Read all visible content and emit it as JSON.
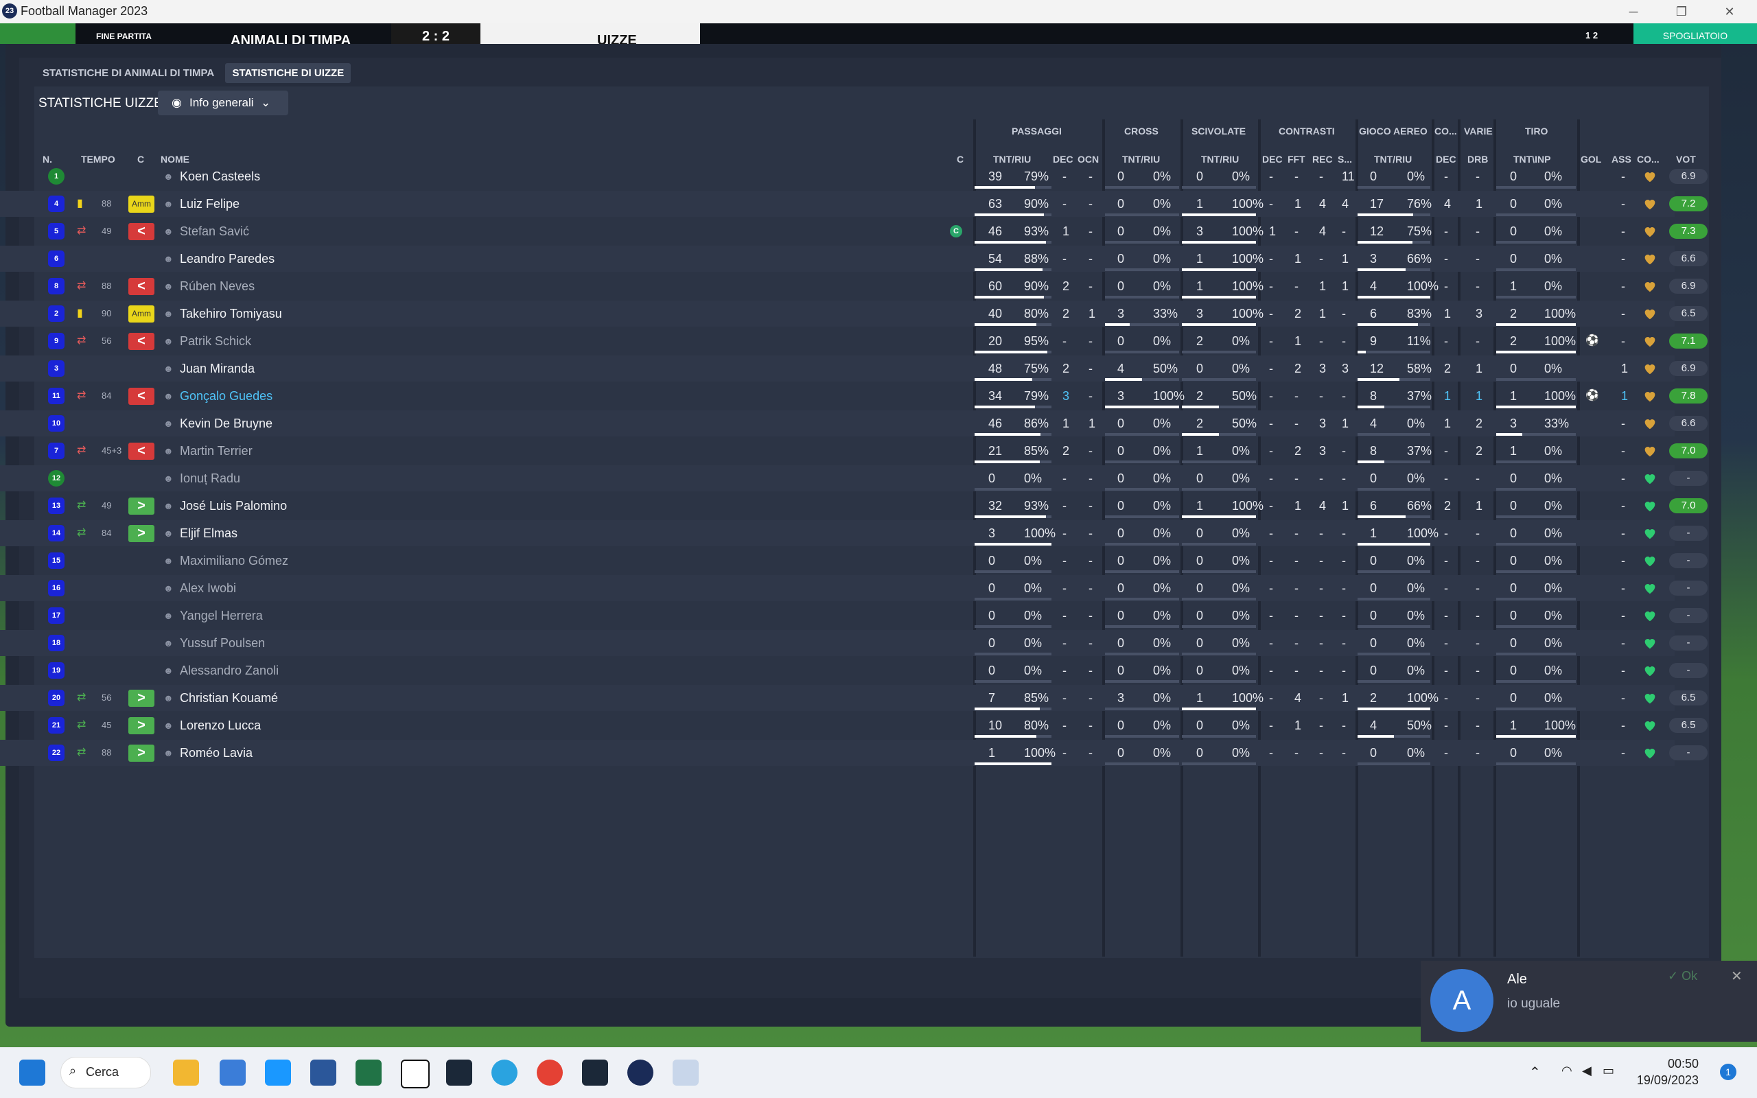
{
  "window": {
    "title": "Football Manager 2023",
    "app_icon": "23"
  },
  "scorebar": {
    "status": "FINE PARTITA",
    "home": "ANIMALI DI TIMPA",
    "score": "2 : 2",
    "away": "UIZZE",
    "extra": "1 2",
    "right": "SPOGLIATOIO"
  },
  "tabs": [
    "STATISTICHE DI ANIMALI DI TIMPA",
    "STATISTICHE DI UIZZE"
  ],
  "section_title": "STATISTICHE UIZZE",
  "view_dropdown": "Info generali",
  "group_headers": {
    "passaggi": "PASSAGGI",
    "cross": "CROSS",
    "scivolate": "SCIVOLATE",
    "contrasti": "CONTRASTI",
    "gioco_aereo": "GIOCO AEREO",
    "co": "CO...",
    "varie": "VARIE",
    "tiro": "TIRO"
  },
  "columns": {
    "n": "N.",
    "tempo": "TEMPO",
    "c": "C",
    "nome": "NOME",
    "c2": "C",
    "pass_tnt": "TNT/RIU",
    "pass_dec": "DEC",
    "pass_ocn": "OCN",
    "cross_tnt": "TNT/RIU",
    "sciv_tnt": "TNT/RIU",
    "con_dec": "DEC",
    "con_fft": "FFT",
    "con_rec": "REC",
    "con_s": "S...",
    "aereo_tnt": "TNT/RIU",
    "co_dec": "DEC",
    "drb": "DRB",
    "tiro_tnt": "TNT\\INP",
    "gol": "GOL",
    "ass": "ASS",
    "cond": "CO...",
    "vot": "VOT"
  },
  "players": [
    {
      "n": "1",
      "kit": "green",
      "card": "",
      "tempo": "",
      "sub": "",
      "name": "Koen Casteels",
      "cap": "",
      "pt": "39",
      "pp": "79%",
      "pd": "-",
      "po": "-",
      "ct": "0",
      "cp": "0%",
      "st": "0",
      "sp": "0%",
      "kd": "-",
      "kf": "-",
      "kr": "-",
      "ks": "11",
      "at": "0",
      "ap": "0%",
      "cd": "-",
      "dr": "-",
      "tt": "0",
      "tp": "0%",
      "gol": "",
      "ass": "-",
      "vot": "6.9",
      "hi": false,
      "bench": false,
      "link": false
    },
    {
      "n": "4",
      "kit": "blue",
      "card": "yellow",
      "tempo": "88",
      "sub": "amm",
      "name": "Luiz Felipe",
      "cap": "",
      "pt": "63",
      "pp": "90%",
      "pd": "-",
      "po": "-",
      "ct": "0",
      "cp": "0%",
      "st": "1",
      "sp": "100%",
      "kd": "-",
      "kf": "1",
      "kr": "4",
      "ks": "4",
      "at": "17",
      "ap": "76%",
      "cd": "4",
      "dr": "1",
      "tt": "0",
      "tp": "0%",
      "gol": "",
      "ass": "-",
      "vot": "7.2",
      "hi": true,
      "bench": false,
      "link": false
    },
    {
      "n": "5",
      "kit": "blue",
      "card": "swap",
      "tempo": "49",
      "sub": "out",
      "name": "Stefan Savić",
      "cap": "C",
      "pt": "46",
      "pp": "93%",
      "pd": "1",
      "po": "-",
      "ct": "0",
      "cp": "0%",
      "st": "3",
      "sp": "100%",
      "kd": "1",
      "kf": "-",
      "kr": "4",
      "ks": "-",
      "at": "12",
      "ap": "75%",
      "cd": "-",
      "dr": "-",
      "tt": "0",
      "tp": "0%",
      "gol": "",
      "ass": "-",
      "vot": "7.3",
      "hi": true,
      "bench": true,
      "link": false
    },
    {
      "n": "6",
      "kit": "blue",
      "card": "",
      "tempo": "",
      "sub": "",
      "name": "Leandro Paredes",
      "cap": "",
      "pt": "54",
      "pp": "88%",
      "pd": "-",
      "po": "-",
      "ct": "0",
      "cp": "0%",
      "st": "1",
      "sp": "100%",
      "kd": "-",
      "kf": "1",
      "kr": "-",
      "ks": "1",
      "at": "3",
      "ap": "66%",
      "cd": "-",
      "dr": "-",
      "tt": "0",
      "tp": "0%",
      "gol": "",
      "ass": "-",
      "vot": "6.6",
      "hi": false,
      "bench": false,
      "link": false
    },
    {
      "n": "8",
      "kit": "blue",
      "card": "swap",
      "tempo": "88",
      "sub": "out",
      "name": "Rúben Neves",
      "cap": "",
      "pt": "60",
      "pp": "90%",
      "pd": "2",
      "po": "-",
      "ct": "0",
      "cp": "0%",
      "st": "1",
      "sp": "100%",
      "kd": "-",
      "kf": "-",
      "kr": "1",
      "ks": "1",
      "at": "4",
      "ap": "100%",
      "cd": "-",
      "dr": "-",
      "tt": "1",
      "tp": "0%",
      "gol": "",
      "ass": "-",
      "vot": "6.9",
      "hi": false,
      "bench": true,
      "link": false
    },
    {
      "n": "2",
      "kit": "blue",
      "card": "yellow",
      "tempo": "90",
      "sub": "amm",
      "name": "Takehiro Tomiyasu",
      "cap": "",
      "pt": "40",
      "pp": "80%",
      "pd": "2",
      "po": "1",
      "ct": "3",
      "cp": "33%",
      "st": "3",
      "sp": "100%",
      "kd": "-",
      "kf": "2",
      "kr": "1",
      "ks": "-",
      "at": "6",
      "ap": "83%",
      "cd": "1",
      "dr": "3",
      "tt": "2",
      "tp": "100%",
      "gol": "",
      "ass": "-",
      "vot": "6.5",
      "hi": false,
      "bench": false,
      "link": false
    },
    {
      "n": "9",
      "kit": "blue",
      "card": "swap",
      "tempo": "56",
      "sub": "out",
      "name": "Patrik Schick",
      "cap": "",
      "pt": "20",
      "pp": "95%",
      "pd": "-",
      "po": "-",
      "ct": "0",
      "cp": "0%",
      "st": "2",
      "sp": "0%",
      "kd": "-",
      "kf": "1",
      "kr": "-",
      "ks": "-",
      "at": "9",
      "ap": "11%",
      "cd": "-",
      "dr": "-",
      "tt": "2",
      "tp": "100%",
      "gol": "ball",
      "ass": "-",
      "vot": "7.1",
      "hi": true,
      "bench": true,
      "link": false
    },
    {
      "n": "3",
      "kit": "blue",
      "card": "",
      "tempo": "",
      "sub": "",
      "name": "Juan Miranda",
      "cap": "",
      "pt": "48",
      "pp": "75%",
      "pd": "2",
      "po": "-",
      "ct": "4",
      "cp": "50%",
      "st": "0",
      "sp": "0%",
      "kd": "-",
      "kf": "2",
      "kr": "3",
      "ks": "3",
      "at": "12",
      "ap": "58%",
      "cd": "2",
      "dr": "1",
      "tt": "0",
      "tp": "0%",
      "gol": "",
      "ass": "1",
      "vot": "6.9",
      "hi": false,
      "bench": false,
      "link": false
    },
    {
      "n": "11",
      "kit": "blue",
      "card": "swap",
      "tempo": "84",
      "sub": "out",
      "name": "Gonçalo Guedes",
      "cap": "",
      "pt": "34",
      "pp": "79%",
      "pd": "3",
      "po": "-",
      "ct": "3",
      "cp": "100%",
      "st": "2",
      "sp": "50%",
      "kd": "-",
      "kf": "-",
      "kr": "-",
      "ks": "-",
      "at": "8",
      "ap": "37%",
      "cd": "1",
      "dr": "1",
      "tt": "1",
      "tp": "100%",
      "gol": "ball",
      "ass": "1",
      "vot": "7.8",
      "hi": true,
      "bench": false,
      "link": true
    },
    {
      "n": "10",
      "kit": "blue",
      "card": "",
      "tempo": "",
      "sub": "",
      "name": "Kevin De Bruyne",
      "cap": "",
      "pt": "46",
      "pp": "86%",
      "pd": "1",
      "po": "1",
      "ct": "0",
      "cp": "0%",
      "st": "2",
      "sp": "50%",
      "kd": "-",
      "kf": "-",
      "kr": "3",
      "ks": "1",
      "at": "4",
      "ap": "0%",
      "cd": "1",
      "dr": "2",
      "tt": "3",
      "tp": "33%",
      "gol": "",
      "ass": "-",
      "vot": "6.6",
      "hi": false,
      "bench": false,
      "link": false
    },
    {
      "n": "7",
      "kit": "blue",
      "card": "swap",
      "tempo": "45+3",
      "sub": "out",
      "name": "Martin Terrier",
      "cap": "",
      "pt": "21",
      "pp": "85%",
      "pd": "2",
      "po": "-",
      "ct": "0",
      "cp": "0%",
      "st": "1",
      "sp": "0%",
      "kd": "-",
      "kf": "2",
      "kr": "3",
      "ks": "-",
      "at": "8",
      "ap": "37%",
      "cd": "-",
      "dr": "2",
      "tt": "1",
      "tp": "0%",
      "gol": "",
      "ass": "-",
      "vot": "7.0",
      "hi": true,
      "bench": true,
      "link": false
    },
    {
      "n": "12",
      "kit": "green",
      "card": "",
      "tempo": "",
      "sub": "",
      "name": "Ionuț Radu",
      "cap": "",
      "pt": "0",
      "pp": "0%",
      "pd": "-",
      "po": "-",
      "ct": "0",
      "cp": "0%",
      "st": "0",
      "sp": "0%",
      "kd": "-",
      "kf": "-",
      "kr": "-",
      "ks": "-",
      "at": "0",
      "ap": "0%",
      "cd": "-",
      "dr": "-",
      "tt": "0",
      "tp": "0%",
      "gol": "",
      "ass": "-",
      "vot": "-",
      "hi": false,
      "bench": true,
      "link": false
    },
    {
      "n": "13",
      "kit": "blue",
      "card": "swapin",
      "tempo": "49",
      "sub": "in",
      "name": "José Luis Palomino",
      "cap": "",
      "pt": "32",
      "pp": "93%",
      "pd": "-",
      "po": "-",
      "ct": "0",
      "cp": "0%",
      "st": "1",
      "sp": "100%",
      "kd": "-",
      "kf": "1",
      "kr": "4",
      "ks": "1",
      "at": "6",
      "ap": "66%",
      "cd": "2",
      "dr": "1",
      "tt": "0",
      "tp": "0%",
      "gol": "",
      "ass": "-",
      "vot": "7.0",
      "hi": true,
      "bench": false,
      "link": false
    },
    {
      "n": "14",
      "kit": "blue",
      "card": "swapin",
      "tempo": "84",
      "sub": "in",
      "name": "Eljif Elmas",
      "cap": "",
      "pt": "3",
      "pp": "100%",
      "pd": "-",
      "po": "-",
      "ct": "0",
      "cp": "0%",
      "st": "0",
      "sp": "0%",
      "kd": "-",
      "kf": "-",
      "kr": "-",
      "ks": "-",
      "at": "1",
      "ap": "100%",
      "cd": "-",
      "dr": "-",
      "tt": "0",
      "tp": "0%",
      "gol": "",
      "ass": "-",
      "vot": "-",
      "hi": false,
      "bench": false,
      "link": false
    },
    {
      "n": "15",
      "kit": "blue",
      "card": "",
      "tempo": "",
      "sub": "",
      "name": "Maximiliano Gómez",
      "cap": "",
      "pt": "0",
      "pp": "0%",
      "pd": "-",
      "po": "-",
      "ct": "0",
      "cp": "0%",
      "st": "0",
      "sp": "0%",
      "kd": "-",
      "kf": "-",
      "kr": "-",
      "ks": "-",
      "at": "0",
      "ap": "0%",
      "cd": "-",
      "dr": "-",
      "tt": "0",
      "tp": "0%",
      "gol": "",
      "ass": "-",
      "vot": "-",
      "hi": false,
      "bench": true,
      "link": false
    },
    {
      "n": "16",
      "kit": "blue",
      "card": "",
      "tempo": "",
      "sub": "",
      "name": "Alex Iwobi",
      "cap": "",
      "pt": "0",
      "pp": "0%",
      "pd": "-",
      "po": "-",
      "ct": "0",
      "cp": "0%",
      "st": "0",
      "sp": "0%",
      "kd": "-",
      "kf": "-",
      "kr": "-",
      "ks": "-",
      "at": "0",
      "ap": "0%",
      "cd": "-",
      "dr": "-",
      "tt": "0",
      "tp": "0%",
      "gol": "",
      "ass": "-",
      "vot": "-",
      "hi": false,
      "bench": true,
      "link": false
    },
    {
      "n": "17",
      "kit": "blue",
      "card": "",
      "tempo": "",
      "sub": "",
      "name": "Yangel Herrera",
      "cap": "",
      "pt": "0",
      "pp": "0%",
      "pd": "-",
      "po": "-",
      "ct": "0",
      "cp": "0%",
      "st": "0",
      "sp": "0%",
      "kd": "-",
      "kf": "-",
      "kr": "-",
      "ks": "-",
      "at": "0",
      "ap": "0%",
      "cd": "-",
      "dr": "-",
      "tt": "0",
      "tp": "0%",
      "gol": "",
      "ass": "-",
      "vot": "-",
      "hi": false,
      "bench": true,
      "link": false
    },
    {
      "n": "18",
      "kit": "blue",
      "card": "",
      "tempo": "",
      "sub": "",
      "name": "Yussuf Poulsen",
      "cap": "",
      "pt": "0",
      "pp": "0%",
      "pd": "-",
      "po": "-",
      "ct": "0",
      "cp": "0%",
      "st": "0",
      "sp": "0%",
      "kd": "-",
      "kf": "-",
      "kr": "-",
      "ks": "-",
      "at": "0",
      "ap": "0%",
      "cd": "-",
      "dr": "-",
      "tt": "0",
      "tp": "0%",
      "gol": "",
      "ass": "-",
      "vot": "-",
      "hi": false,
      "bench": true,
      "link": false
    },
    {
      "n": "19",
      "kit": "blue",
      "card": "",
      "tempo": "",
      "sub": "",
      "name": "Alessandro Zanoli",
      "cap": "",
      "pt": "0",
      "pp": "0%",
      "pd": "-",
      "po": "-",
      "ct": "0",
      "cp": "0%",
      "st": "0",
      "sp": "0%",
      "kd": "-",
      "kf": "-",
      "kr": "-",
      "ks": "-",
      "at": "0",
      "ap": "0%",
      "cd": "-",
      "dr": "-",
      "tt": "0",
      "tp": "0%",
      "gol": "",
      "ass": "-",
      "vot": "-",
      "hi": false,
      "bench": true,
      "link": false
    },
    {
      "n": "20",
      "kit": "blue",
      "card": "swapin",
      "tempo": "56",
      "sub": "in",
      "name": "Christian Kouamé",
      "cap": "",
      "pt": "7",
      "pp": "85%",
      "pd": "-",
      "po": "-",
      "ct": "3",
      "cp": "0%",
      "st": "1",
      "sp": "100%",
      "kd": "-",
      "kf": "4",
      "kr": "-",
      "ks": "1",
      "at": "2",
      "ap": "100%",
      "cd": "-",
      "dr": "-",
      "tt": "0",
      "tp": "0%",
      "gol": "",
      "ass": "-",
      "vot": "6.5",
      "hi": false,
      "bench": false,
      "link": false
    },
    {
      "n": "21",
      "kit": "blue",
      "card": "swapin",
      "tempo": "45",
      "sub": "in",
      "name": "Lorenzo Lucca",
      "cap": "",
      "pt": "10",
      "pp": "80%",
      "pd": "-",
      "po": "-",
      "ct": "0",
      "cp": "0%",
      "st": "0",
      "sp": "0%",
      "kd": "-",
      "kf": "1",
      "kr": "-",
      "ks": "-",
      "at": "4",
      "ap": "50%",
      "cd": "-",
      "dr": "-",
      "tt": "1",
      "tp": "100%",
      "gol": "",
      "ass": "-",
      "vot": "6.5",
      "hi": false,
      "bench": false,
      "link": false
    },
    {
      "n": "22",
      "kit": "blue",
      "card": "swapin",
      "tempo": "88",
      "sub": "in",
      "name": "Roméo Lavia",
      "cap": "",
      "pt": "1",
      "pp": "100%",
      "pd": "-",
      "po": "-",
      "ct": "0",
      "cp": "0%",
      "st": "0",
      "sp": "0%",
      "kd": "-",
      "kf": "-",
      "kr": "-",
      "ks": "-",
      "at": "0",
      "ap": "0%",
      "cd": "-",
      "dr": "-",
      "tt": "0",
      "tp": "0%",
      "gol": "",
      "ass": "-",
      "vot": "-",
      "hi": false,
      "bench": false,
      "link": false
    }
  ],
  "badge_labels": {
    "amm": "Amm",
    "out": "<",
    "in": ">"
  },
  "chat": {
    "avatar": "A",
    "sender": "Ale",
    "message": "io uguale",
    "ok": "✓ Ok"
  },
  "taskbar": {
    "search": "Cerca",
    "time": "00:50",
    "date": "19/09/2023",
    "notif": "1"
  },
  "colors": {
    "kit_blue": "#1a24d8",
    "kit_green": "#1f8a35",
    "vote_high": "#3aa23a",
    "amm": "#e9d61a",
    "sub_out": "#d63a3a",
    "sub_in": "#4caf50",
    "link": "#4fc3f7"
  }
}
